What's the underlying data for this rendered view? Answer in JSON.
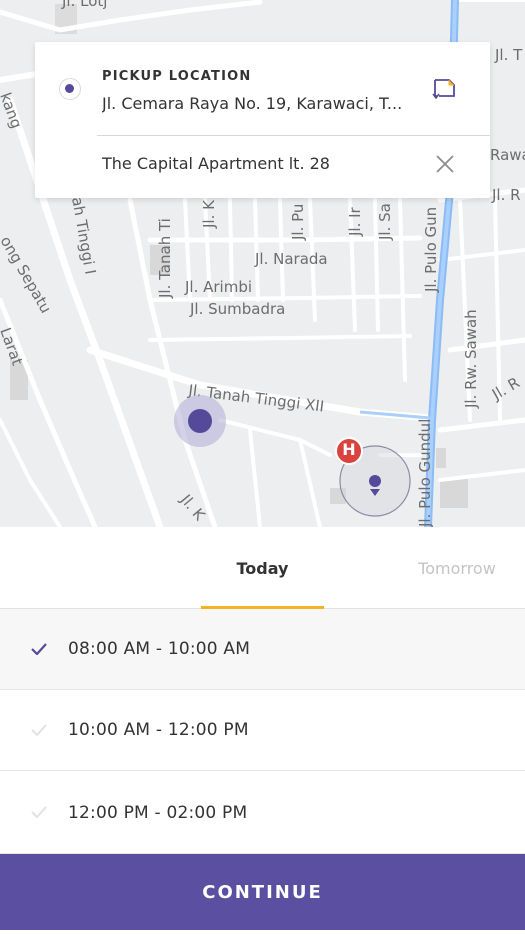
{
  "map": {
    "streets": [
      "Jl. Narada",
      "Jl. Arimbi",
      "Jl. Sumbadra",
      "Jl. Tanah Tinggi XII",
      "Jl. Pulo Gundul",
      "Jl. Pulo Gun",
      "Jl. Rw. Sawah",
      "Jl. Tanah Ti",
      "ah Tinggi I",
      "ong Sepatu",
      "Larat",
      "kang",
      "Jl. Ir",
      "Jl. Sa",
      "Jl. Pu",
      "Jl. R",
      "Jl. T",
      "Rawa",
      "Jl. K",
      "Jl. Lotj"
    ],
    "hospital_marker": "H",
    "colors": {
      "background": "#eceeef",
      "road": "#ffffff",
      "main_road": "#7fb3f5",
      "marker": "#55499a",
      "hospital": "#d9423f"
    }
  },
  "card": {
    "pickup_title": "PICKUP LOCATION",
    "pickup_address": "Jl. Cemara Raya No. 19, Karawaci, T...",
    "destination": "The Capital Apartment lt. 28",
    "edit_icon": "edit-note-icon",
    "close_icon": "close-icon"
  },
  "tabs": {
    "today": "Today",
    "tomorrow": "Tomorrow",
    "active": "today",
    "accent_color": "#f5b324"
  },
  "slots": [
    {
      "label": "08:00 AM - 10:00 AM",
      "selected": true
    },
    {
      "label": "10:00 AM - 12:00 PM",
      "selected": false
    },
    {
      "label": "12:00 PM - 02:00 PM",
      "selected": false
    }
  ],
  "continue_button": {
    "label": "CONTINUE",
    "color": "#5a4fa0"
  }
}
